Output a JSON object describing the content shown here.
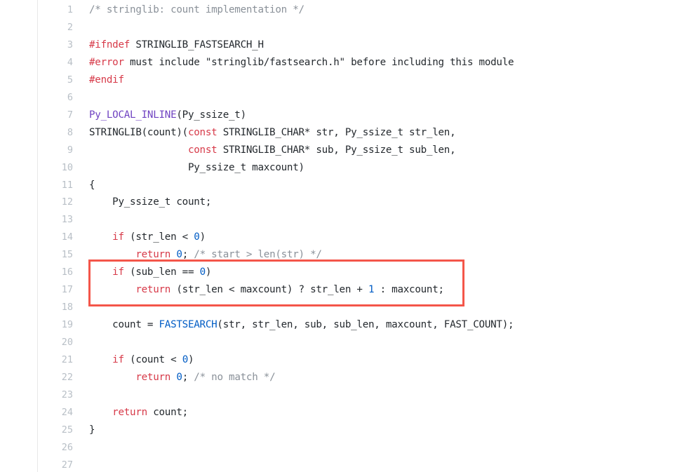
{
  "viewer": {
    "name": "code-viewer",
    "background": "#ffffff",
    "gutter_divider_color": "#e8e8e8",
    "line_number_color": "#b8bfc6",
    "first_line": 1,
    "last_line": 27,
    "total_lines": 27
  },
  "colors": {
    "plain": "#24292e",
    "comment": "#8a9199",
    "keyword": "#d73a49",
    "preprocessor": "#d73a49",
    "number": "#005cc5",
    "function": "#005cc5",
    "macro": "#6f42c1",
    "annotation": "#f4564a"
  },
  "annotation": {
    "type": "rectangle-highlight",
    "color": "#f4564a",
    "covers_lines": "16-17",
    "label": ""
  },
  "code": {
    "language": "c",
    "lines": [
      {
        "n": "1",
        "tokens": [
          {
            "t": "/* stringlib: count implementation */",
            "c": "comment"
          }
        ]
      },
      {
        "n": "2",
        "tokens": []
      },
      {
        "n": "3",
        "tokens": [
          {
            "t": "#ifndef",
            "c": "preproc"
          },
          {
            "t": " STRINGLIB_FASTSEARCH_H",
            "c": "plain"
          }
        ]
      },
      {
        "n": "4",
        "tokens": [
          {
            "t": "#error",
            "c": "preproc"
          },
          {
            "t": " must include \"stringlib/fastsearch.h\" before including this module",
            "c": "plain"
          }
        ]
      },
      {
        "n": "5",
        "tokens": [
          {
            "t": "#endif",
            "c": "preproc"
          }
        ]
      },
      {
        "n": "6",
        "tokens": []
      },
      {
        "n": "7",
        "tokens": [
          {
            "t": "Py_LOCAL_INLINE",
            "c": "macro"
          },
          {
            "t": "(Py_ssize_t)",
            "c": "plain"
          }
        ]
      },
      {
        "n": "8",
        "tokens": [
          {
            "t": "STRINGLIB(count)(",
            "c": "plain"
          },
          {
            "t": "const",
            "c": "keyword"
          },
          {
            "t": " STRINGLIB_CHAR* str, Py_ssize_t str_len,",
            "c": "plain"
          }
        ]
      },
      {
        "n": "9",
        "tokens": [
          {
            "t": "                 ",
            "c": "plain"
          },
          {
            "t": "const",
            "c": "keyword"
          },
          {
            "t": " STRINGLIB_CHAR* sub, Py_ssize_t sub_len,",
            "c": "plain"
          }
        ]
      },
      {
        "n": "10",
        "tokens": [
          {
            "t": "                 Py_ssize_t maxcount)",
            "c": "plain"
          }
        ]
      },
      {
        "n": "11",
        "tokens": [
          {
            "t": "{",
            "c": "plain"
          }
        ]
      },
      {
        "n": "12",
        "tokens": [
          {
            "t": "    Py_ssize_t count;",
            "c": "plain"
          }
        ]
      },
      {
        "n": "13",
        "tokens": []
      },
      {
        "n": "14",
        "tokens": [
          {
            "t": "    ",
            "c": "plain"
          },
          {
            "t": "if",
            "c": "keyword"
          },
          {
            "t": " (str_len < ",
            "c": "plain"
          },
          {
            "t": "0",
            "c": "number"
          },
          {
            "t": ")",
            "c": "plain"
          }
        ]
      },
      {
        "n": "15",
        "tokens": [
          {
            "t": "        ",
            "c": "plain"
          },
          {
            "t": "return",
            "c": "keyword"
          },
          {
            "t": " ",
            "c": "plain"
          },
          {
            "t": "0",
            "c": "number"
          },
          {
            "t": "; ",
            "c": "plain"
          },
          {
            "t": "/* start > len(str) */",
            "c": "comment"
          }
        ]
      },
      {
        "n": "16",
        "tokens": [
          {
            "t": "    ",
            "c": "plain"
          },
          {
            "t": "if",
            "c": "keyword"
          },
          {
            "t": " (sub_len == ",
            "c": "plain"
          },
          {
            "t": "0",
            "c": "number"
          },
          {
            "t": ")",
            "c": "plain"
          }
        ]
      },
      {
        "n": "17",
        "tokens": [
          {
            "t": "        ",
            "c": "plain"
          },
          {
            "t": "return",
            "c": "keyword"
          },
          {
            "t": " (str_len < maxcount) ? str_len + ",
            "c": "plain"
          },
          {
            "t": "1",
            "c": "number"
          },
          {
            "t": " : maxcount;",
            "c": "plain"
          }
        ]
      },
      {
        "n": "18",
        "tokens": []
      },
      {
        "n": "19",
        "tokens": [
          {
            "t": "    count = ",
            "c": "plain"
          },
          {
            "t": "FASTSEARCH",
            "c": "func"
          },
          {
            "t": "(str, str_len, sub, sub_len, maxcount, FAST_COUNT);",
            "c": "plain"
          }
        ]
      },
      {
        "n": "20",
        "tokens": []
      },
      {
        "n": "21",
        "tokens": [
          {
            "t": "    ",
            "c": "plain"
          },
          {
            "t": "if",
            "c": "keyword"
          },
          {
            "t": " (count < ",
            "c": "plain"
          },
          {
            "t": "0",
            "c": "number"
          },
          {
            "t": ")",
            "c": "plain"
          }
        ]
      },
      {
        "n": "22",
        "tokens": [
          {
            "t": "        ",
            "c": "plain"
          },
          {
            "t": "return",
            "c": "keyword"
          },
          {
            "t": " ",
            "c": "plain"
          },
          {
            "t": "0",
            "c": "number"
          },
          {
            "t": "; ",
            "c": "plain"
          },
          {
            "t": "/* no match */",
            "c": "comment"
          }
        ]
      },
      {
        "n": "23",
        "tokens": []
      },
      {
        "n": "24",
        "tokens": [
          {
            "t": "    ",
            "c": "plain"
          },
          {
            "t": "return",
            "c": "keyword"
          },
          {
            "t": " count;",
            "c": "plain"
          }
        ]
      },
      {
        "n": "25",
        "tokens": [
          {
            "t": "}",
            "c": "plain"
          }
        ]
      },
      {
        "n": "26",
        "tokens": []
      },
      {
        "n": "27",
        "tokens": []
      }
    ]
  }
}
